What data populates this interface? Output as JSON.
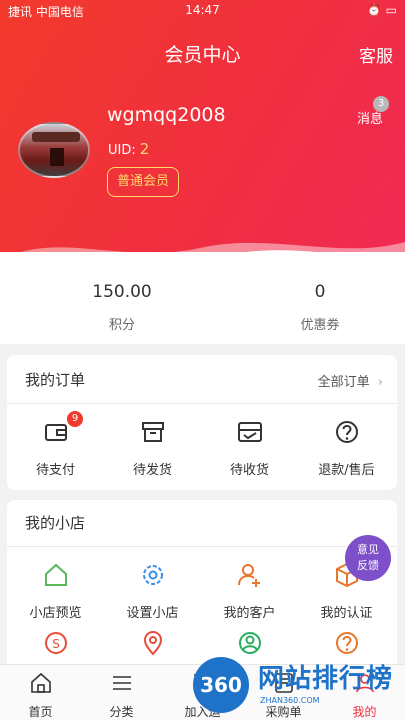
{
  "status_bar": {
    "left": "捷讯 中国电信",
    "time": "14:47",
    "right": "⏰ ▭"
  },
  "header": {
    "title": "会员中心",
    "service": "客服",
    "message_label": "消息",
    "message_count": "3"
  },
  "user": {
    "name": "wgmqq2008",
    "uid_label": "UID:",
    "uid_value": "2",
    "level": "普通会员"
  },
  "stats": [
    {
      "value": "150.00",
      "label": "积分"
    },
    {
      "value": "0",
      "label": "优惠券"
    }
  ],
  "orders": {
    "title": "我的订单",
    "all_label": "全部订单",
    "items": [
      {
        "label": "待支付",
        "badge": "9",
        "icon": "wallet-icon"
      },
      {
        "label": "待发货",
        "icon": "box-icon"
      },
      {
        "label": "待收货",
        "icon": "truck-icon"
      },
      {
        "label": "退款/售后",
        "icon": "question-icon"
      }
    ]
  },
  "shop": {
    "title": "我的小店",
    "items": [
      {
        "label": "小店预览",
        "icon": "home-icon",
        "color": "#5cb85c"
      },
      {
        "label": "设置小店",
        "icon": "gear-icon",
        "color": "#3a8ee6"
      },
      {
        "label": "我的客户",
        "icon": "add-user-icon",
        "color": "#e8762c"
      },
      {
        "label": "我的认证",
        "icon": "cube-icon",
        "color": "#e8762c"
      }
    ],
    "row2_icons": [
      {
        "icon": "coin-icon",
        "color": "#e74c3c"
      },
      {
        "icon": "location-icon",
        "color": "#e74c3c"
      },
      {
        "icon": "user-icon",
        "color": "#27ae60"
      },
      {
        "icon": "help-icon",
        "color": "#e8762c"
      }
    ]
  },
  "feedback": {
    "line1": "意见",
    "line2": "反馈"
  },
  "tabbar": [
    {
      "label": "首页",
      "icon": "home-tab-icon"
    },
    {
      "label": "分类",
      "icon": "menu-icon"
    },
    {
      "label": "加入运",
      "icon": "cart-add-icon"
    },
    {
      "label": "采购单",
      "icon": "list-icon"
    },
    {
      "label": "我的",
      "icon": "profile-icon"
    }
  ],
  "watermark": {
    "logo": "360",
    "text": "网站排行榜",
    "sub": "ZHAN360.COM"
  },
  "colors": {
    "brand_red": "#f02f3f",
    "gold": "#ffd86a",
    "feedback_purple": "#7d4fc9"
  }
}
